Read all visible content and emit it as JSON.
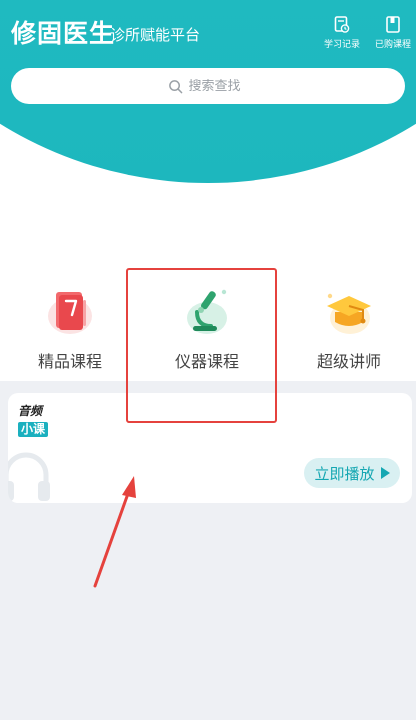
{
  "header": {
    "app_name": "修固医生",
    "slogan": "诊所赋能平台",
    "actions": [
      {
        "label": "学习记录",
        "icon": "study-history-icon"
      },
      {
        "label": "已购课程",
        "icon": "purchased-courses-icon"
      }
    ]
  },
  "search": {
    "placeholder": "搜索查找",
    "value": "",
    "icon": "search-icon"
  },
  "categories": [
    {
      "label": "精品课程",
      "icon": "book-icon"
    },
    {
      "label": "仪器课程",
      "icon": "microscope-icon"
    },
    {
      "label": "超级讲师",
      "icon": "graduation-cap-icon"
    }
  ],
  "audio_card": {
    "badge_top": "音频",
    "badge_bottom": "小课",
    "play_label": "立即播放"
  },
  "colors": {
    "brand": "#1db7be",
    "annotation": "#e5423d",
    "background": "#eef0f4"
  }
}
